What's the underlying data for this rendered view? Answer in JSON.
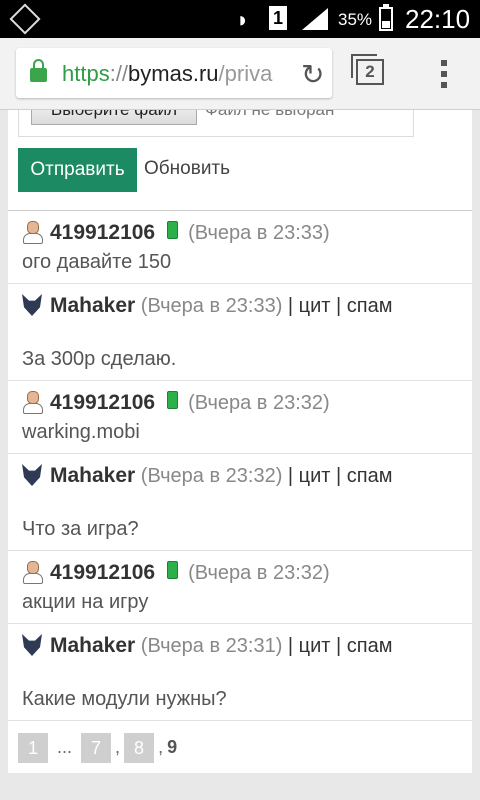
{
  "status_bar": {
    "battery_percent": "35%",
    "time": "22:10",
    "sim_slot": "1"
  },
  "browser": {
    "url_scheme": "https",
    "url_sep": "://",
    "url_host": "bymas.ru",
    "url_path": "/priva",
    "tab_count": "2"
  },
  "form": {
    "file_button": "Выберите файл",
    "file_status": "Файл не выбран",
    "send_button": "Отправить",
    "refresh_link": "Обновить"
  },
  "messages": [
    {
      "type": "user",
      "name": "419912106",
      "time": "(Вчера в 23:33)",
      "text": "ого давайте 150"
    },
    {
      "type": "admin",
      "name": "Mahaker",
      "time": "(Вчера в 23:33)",
      "action1": "цит",
      "action2": "спам",
      "sep": " | ",
      "text": "За 300р сделаю."
    },
    {
      "type": "user",
      "name": "419912106",
      "time": "(Вчера в 23:32)",
      "text": "warking.mobi"
    },
    {
      "type": "admin",
      "name": "Mahaker",
      "time": "(Вчера в 23:32)",
      "action1": "цит",
      "action2": "спам",
      "sep": " | ",
      "text": "Что за игра?"
    },
    {
      "type": "user",
      "name": "419912106",
      "time": "(Вчера в 23:32)",
      "text": "акции на игру"
    },
    {
      "type": "admin",
      "name": "Mahaker",
      "time": "(Вчера в 23:31)",
      "action1": "цит",
      "action2": "спам",
      "sep": " | ",
      "text": "Какие модули нужны?"
    }
  ],
  "pagination": {
    "p1": "1",
    "ellipsis": "...",
    "p7": "7",
    "p8": "8",
    "comma": ",",
    "current": "9"
  },
  "colors": {
    "accent_green": "#1c8a62",
    "secure_green": "#2e9d46"
  }
}
